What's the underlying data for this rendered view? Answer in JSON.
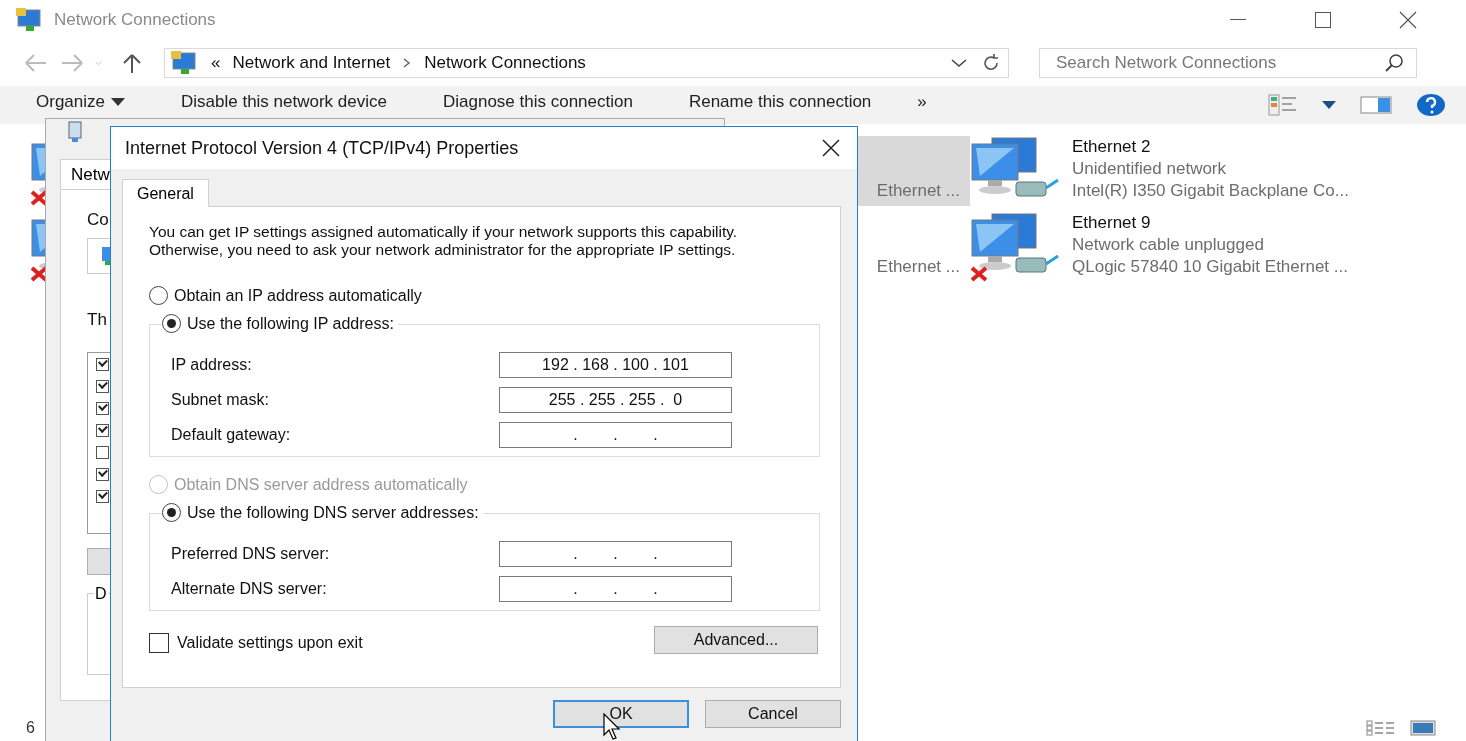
{
  "explorer": {
    "title": "Network Connections",
    "address": {
      "prefix": "«",
      "crumbs": [
        "Network and Internet",
        "Network Connections"
      ]
    },
    "search": {
      "placeholder": "Search Network Connections"
    },
    "toolbar": [
      {
        "label": "Organize",
        "dropdown": true
      },
      {
        "label": "Disable this network device",
        "dropdown": false
      },
      {
        "label": "Diagnose this connection",
        "dropdown": false
      },
      {
        "label": "Rename this connection",
        "dropdown": false
      }
    ],
    "toolbar_overflow": "»",
    "connections": [
      {
        "unplugged": true,
        "selected": false
      },
      {
        "unplugged": true,
        "selected": false
      },
      {
        "device": "Ethernet ...",
        "selected": true
      },
      {
        "device": "Ethernet ...",
        "selected": false
      },
      {
        "name": "Ethernet 2",
        "status": "Unidentified network",
        "device": "Intel(R) I350 Gigabit Backplane Co...",
        "unplugged": false,
        "selected": false
      },
      {
        "name": "Ethernet 9",
        "status": "Network cable unplugged",
        "device": "QLogic 57840 10 Gigabit Ethernet ...",
        "unplugged": true,
        "selected": false
      }
    ],
    "status_bar": {
      "count": "6"
    }
  },
  "back_dialog": {
    "tab": "Netw",
    "label_1": "Co",
    "label_2": "Th",
    "label_3": "D",
    "components": [
      {
        "checked": true
      },
      {
        "checked": true
      },
      {
        "checked": true
      },
      {
        "checked": true
      },
      {
        "checked": false
      },
      {
        "checked": true
      },
      {
        "checked": true
      }
    ]
  },
  "dialog": {
    "title": "Internet Protocol Version 4 (TCP/IPv4) Properties",
    "tab": "General",
    "intro": "You can get IP settings assigned automatically if your network supports this capability. Otherwise, you need to ask your network administrator for the appropriate IP settings.",
    "ip_modes": [
      {
        "label": "Obtain an IP address automatically",
        "selected": false,
        "disabled": false
      },
      {
        "label": "Use the following IP address:",
        "selected": true,
        "disabled": false
      }
    ],
    "ip_fields": [
      {
        "label": "IP address:",
        "value": "192 . 168 . 100 . 101"
      },
      {
        "label": "Subnet mask:",
        "value": "255 . 255 . 255 .  0"
      },
      {
        "label": "Default gateway:",
        "value": ".        .        ."
      }
    ],
    "dns_modes": [
      {
        "label": "Obtain DNS server address automatically",
        "selected": false,
        "disabled": true
      },
      {
        "label": "Use the following DNS server addresses:",
        "selected": true,
        "disabled": false
      }
    ],
    "dns_fields": [
      {
        "label": "Preferred DNS server:",
        "value": ".        .        ."
      },
      {
        "label": "Alternate DNS server:",
        "value": ".        .        ."
      }
    ],
    "validate": {
      "label": "Validate settings upon exit",
      "checked": false
    },
    "advanced": "Advanced...",
    "buttons": [
      {
        "label": "OK",
        "focused": true
      },
      {
        "label": "Cancel",
        "focused": false
      }
    ]
  }
}
